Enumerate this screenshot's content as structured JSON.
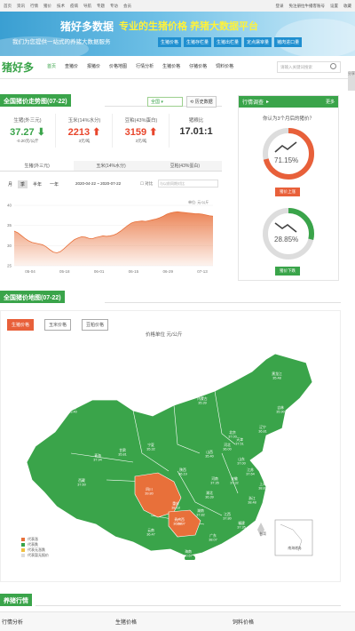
{
  "topbar": {
    "links": [
      "首页",
      "资讯",
      "行情",
      "猪价",
      "技术",
      "疫病",
      "导航",
      "专题",
      "专访",
      "会员"
    ],
    "right": [
      "登录",
      "免注册拉牛播客账号",
      "设置",
      "收藏"
    ]
  },
  "banner": {
    "brand": "猪好多数据",
    "slogan": "专业的生猪价格 养猪大数据平台",
    "subtitle": "我们为您提供一站式的养猪大数据服务",
    "quick_links": [
      "生猪价格",
      "生猪存栏量",
      "生猪出栏量",
      "定点屠宰量",
      "猪肉进口量"
    ]
  },
  "logo": "猪好多",
  "nav": {
    "items": [
      "首页",
      "查猪价",
      "报猪价",
      "价格地图",
      "行情分析",
      "生猪价格",
      "仔猪价格",
      "饲料价格"
    ],
    "active": 0,
    "search_placeholder": "请输入关键词搜索"
  },
  "trend": {
    "title": "全国猪价走势图(07-22)",
    "region_select": "全国",
    "button": "历史数据",
    "stats": [
      {
        "label": "生猪(外三元)",
        "value": "37.27",
        "change": "-0.20元/公斤",
        "dir": "down"
      },
      {
        "label": "玉米(14%水分)",
        "value": "2213",
        "change": "3元/吨",
        "dir": "up"
      },
      {
        "label": "豆粕(43%蛋白)",
        "value": "3159",
        "change": "3元/吨",
        "dir": "up"
      },
      {
        "label": "猪粮比",
        "value": "17.01:1",
        "change": "",
        "dir": ""
      }
    ],
    "tabs": [
      "生猪(外三元)",
      "玉米(14%水分)",
      "豆粕(43%蛋白)"
    ],
    "periods": [
      "月",
      "季",
      "半年",
      "一年"
    ],
    "date_range": "2020-04-22 ~ 2020-07-22",
    "compare_label": "对比",
    "compare_placeholder": "与以前同期对比",
    "unit": "单位: 元/公斤"
  },
  "chart_data": {
    "type": "area",
    "x_ticks": [
      "05-04",
      "05-18",
      "06-01",
      "06-15",
      "06-29",
      "07-13"
    ],
    "y_ticks": [
      25,
      30,
      35,
      40
    ],
    "ylim": [
      25,
      40
    ],
    "color": "#e8703a",
    "values": [
      33.6,
      33.2,
      32.5,
      31.8,
      31.2,
      30.8,
      30.6,
      30.4,
      30.2,
      29.7,
      29.0,
      28.4,
      28.2,
      28.5,
      29.2,
      30.0,
      30.8,
      31.5,
      31.9,
      32.2,
      32.1,
      31.8,
      31.7,
      32.0,
      32.2,
      32.4,
      32.3,
      32.4,
      32.6,
      33.0,
      33.6,
      34.3,
      35.0,
      35.6,
      35.9,
      36.0,
      36.1,
      36.0,
      36.2,
      36.4,
      36.6,
      36.9,
      37.3,
      37.8,
      38.1,
      38.3,
      38.4,
      38.3,
      38.2,
      38.1,
      38.0,
      37.9,
      37.9,
      37.8,
      37.6,
      37.4,
      37.3
    ]
  },
  "poll": {
    "title": "行情调查",
    "more": "更多",
    "question": "你认为3个月后的猪价？",
    "up_pct": "71.15%",
    "up_value": 71.15,
    "up_button": "猪价上涨",
    "down_pct": "28.85%",
    "down_value": 28.85,
    "down_button": "猪价下跌",
    "up_color": "#e8603a",
    "down_color": "#3aa44a"
  },
  "map": {
    "title": "全国猪价地图(07-22)",
    "buttons": [
      "生猪价格",
      "玉米价格",
      "豆粕价格"
    ],
    "unit_title": "价格单位 元/公斤",
    "legend": [
      "代表涨",
      "代表跌",
      "代表无涨跌",
      "代表暂无报价"
    ],
    "legend_colors": [
      "#e8703a",
      "#3aa44a",
      "#f0c040",
      "#ddd"
    ],
    "provinces": [
      {
        "name": "黑龙江",
        "price": "35.48"
      },
      {
        "name": "吉林",
        "price": "35.90"
      },
      {
        "name": "辽宁",
        "price": "36.81"
      },
      {
        "name": "内蒙古",
        "price": "35.39"
      },
      {
        "name": "新疆",
        "price": "33.40"
      },
      {
        "name": "甘肃",
        "price": "35.81"
      },
      {
        "name": "宁夏",
        "price": "35.32"
      },
      {
        "name": "北京",
        "price": "37.00"
      },
      {
        "name": "天津",
        "price": "37.51"
      },
      {
        "name": "河北",
        "price": "36.00"
      },
      {
        "name": "山西",
        "price": "35.40"
      },
      {
        "name": "山东",
        "price": "37.00"
      },
      {
        "name": "河南",
        "price": "37.35"
      },
      {
        "name": "陕西",
        "price": "36.19"
      },
      {
        "name": "青海",
        "price": "37.94"
      },
      {
        "name": "西藏",
        "price": "37.60"
      },
      {
        "name": "四川",
        "price": "39.80"
      },
      {
        "name": "重庆",
        "price": "38.18"
      },
      {
        "name": "湖北",
        "price": "36.39"
      },
      {
        "name": "安徽",
        "price": "37.32"
      },
      {
        "name": "江苏",
        "price": "37.64"
      },
      {
        "name": "上海",
        "price": "38.83"
      },
      {
        "name": "浙江",
        "price": "38.48"
      },
      {
        "name": "湖南",
        "price": "37.82"
      },
      {
        "name": "江西",
        "price": "37.80"
      },
      {
        "name": "福建",
        "price": "37.35"
      },
      {
        "name": "贵州",
        "price": "36.68"
      },
      {
        "name": "云南",
        "price": "36.47"
      },
      {
        "name": "广西",
        "price": "39.97"
      },
      {
        "name": "广东",
        "price": "38.07"
      },
      {
        "name": "海南",
        "price": "40.67"
      },
      {
        "name": "台湾",
        "price": ""
      },
      {
        "name": "南海诸岛",
        "price": ""
      }
    ]
  },
  "bottom": {
    "title": "养猪行情",
    "columns": [
      "行情分析",
      "生猪价格",
      "饲料价格"
    ]
  },
  "sidebar_tab": "分享"
}
